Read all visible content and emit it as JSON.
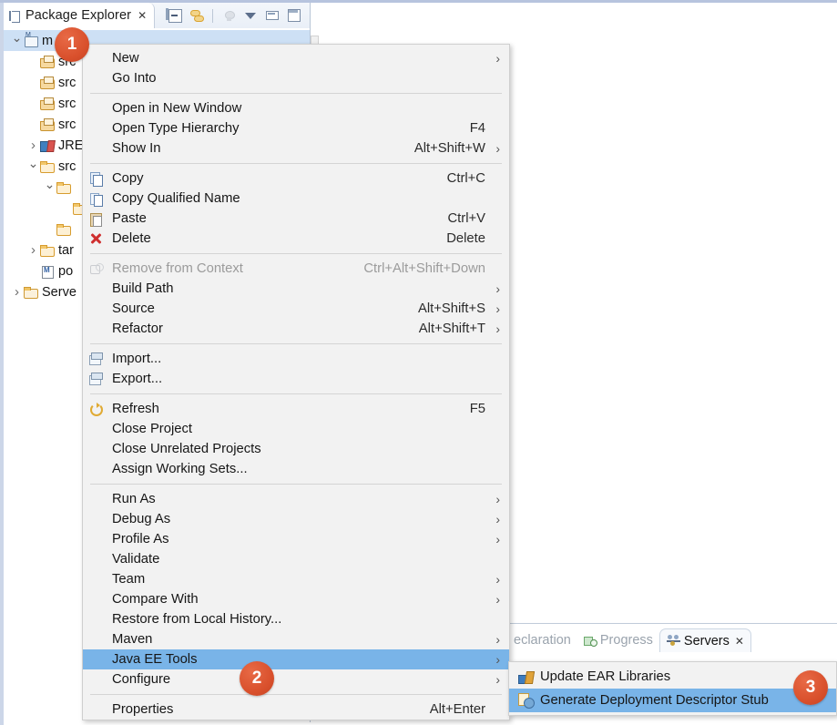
{
  "view": {
    "tab_title": "Package Explorer",
    "close_glyph": "✕",
    "toolbar": [
      {
        "name": "collapse-all-icon",
        "title": "Collapse All"
      },
      {
        "name": "link-with-editor-icon",
        "title": "Link with Editor"
      },
      {
        "name": "focus-on-active-task-icon",
        "title": "Focus on Active Task"
      },
      {
        "name": "view-menu-icon",
        "title": "View Menu"
      },
      {
        "name": "minimize-icon",
        "title": "Minimize"
      },
      {
        "name": "maximize-icon",
        "title": "Maximize"
      }
    ]
  },
  "tree": [
    {
      "arrow": "down",
      "icon": "project-icon",
      "label": "m      -first",
      "selected": true,
      "indent": 0
    },
    {
      "arrow": "none",
      "icon": "source-folder-icon",
      "label": "src",
      "selected": false,
      "indent": 1
    },
    {
      "arrow": "none",
      "icon": "source-folder-icon",
      "label": "src",
      "selected": false,
      "indent": 1
    },
    {
      "arrow": "none",
      "icon": "source-folder-icon",
      "label": "src",
      "selected": false,
      "indent": 1
    },
    {
      "arrow": "none",
      "icon": "source-folder-icon",
      "label": "src",
      "selected": false,
      "indent": 1
    },
    {
      "arrow": "right",
      "icon": "jre-library-icon",
      "label": "JRE",
      "selected": false,
      "indent": 1
    },
    {
      "arrow": "down",
      "icon": "folder-icon",
      "label": "src",
      "selected": false,
      "indent": 1
    },
    {
      "arrow": "down",
      "icon": "folder-icon",
      "label": "",
      "selected": false,
      "indent": 2
    },
    {
      "arrow": "none",
      "icon": "folder-icon",
      "label": "",
      "selected": false,
      "indent": 3
    },
    {
      "arrow": "none",
      "icon": "folder-icon",
      "label": "",
      "selected": false,
      "indent": 2
    },
    {
      "arrow": "right",
      "icon": "folder-icon",
      "label": "tar",
      "selected": false,
      "indent": 1
    },
    {
      "arrow": "none",
      "icon": "pom-file-icon",
      "label": "po",
      "selected": false,
      "indent": 1
    },
    {
      "arrow": "right",
      "icon": "servers-folder-icon",
      "label": "Serve",
      "selected": false,
      "indent": 0
    }
  ],
  "context_menu": [
    {
      "type": "item",
      "label": "New",
      "key": "",
      "arrow": true,
      "icon": "",
      "disabled": false,
      "highlight": false
    },
    {
      "type": "item",
      "label": "Go Into",
      "key": "",
      "arrow": false,
      "icon": "",
      "disabled": false,
      "highlight": false
    },
    {
      "type": "sep"
    },
    {
      "type": "item",
      "label": "Open in New Window",
      "key": "",
      "arrow": false,
      "icon": "",
      "disabled": false,
      "highlight": false
    },
    {
      "type": "item",
      "label": "Open Type Hierarchy",
      "key": "F4",
      "arrow": false,
      "icon": "",
      "disabled": false,
      "highlight": false
    },
    {
      "type": "item",
      "label": "Show In",
      "key": "Alt+Shift+W",
      "arrow": true,
      "icon": "",
      "disabled": false,
      "highlight": false
    },
    {
      "type": "sep"
    },
    {
      "type": "item",
      "label": "Copy",
      "key": "Ctrl+C",
      "arrow": false,
      "icon": "copy-icon",
      "disabled": false,
      "highlight": false
    },
    {
      "type": "item",
      "label": "Copy Qualified Name",
      "key": "",
      "arrow": false,
      "icon": "copy-qualified-name-icon",
      "disabled": false,
      "highlight": false
    },
    {
      "type": "item",
      "label": "Paste",
      "key": "Ctrl+V",
      "arrow": false,
      "icon": "paste-icon",
      "disabled": false,
      "highlight": false
    },
    {
      "type": "item",
      "label": "Delete",
      "key": "Delete",
      "arrow": false,
      "icon": "delete-icon",
      "disabled": false,
      "highlight": false
    },
    {
      "type": "sep"
    },
    {
      "type": "item",
      "label": "Remove from Context",
      "key": "Ctrl+Alt+Shift+Down",
      "arrow": false,
      "icon": "remove-from-context-icon",
      "disabled": true,
      "highlight": false
    },
    {
      "type": "item",
      "label": "Build Path",
      "key": "",
      "arrow": true,
      "icon": "",
      "disabled": false,
      "highlight": false
    },
    {
      "type": "item",
      "label": "Source",
      "key": "Alt+Shift+S",
      "arrow": true,
      "icon": "",
      "disabled": false,
      "highlight": false
    },
    {
      "type": "item",
      "label": "Refactor",
      "key": "Alt+Shift+T",
      "arrow": true,
      "icon": "",
      "disabled": false,
      "highlight": false
    },
    {
      "type": "sep"
    },
    {
      "type": "item",
      "label": "Import...",
      "key": "",
      "arrow": false,
      "icon": "import-icon",
      "disabled": false,
      "highlight": false
    },
    {
      "type": "item",
      "label": "Export...",
      "key": "",
      "arrow": false,
      "icon": "export-icon",
      "disabled": false,
      "highlight": false
    },
    {
      "type": "sep"
    },
    {
      "type": "item",
      "label": "Refresh",
      "key": "F5",
      "arrow": false,
      "icon": "refresh-icon",
      "disabled": false,
      "highlight": false
    },
    {
      "type": "item",
      "label": "Close Project",
      "key": "",
      "arrow": false,
      "icon": "",
      "disabled": false,
      "highlight": false
    },
    {
      "type": "item",
      "label": "Close Unrelated Projects",
      "key": "",
      "arrow": false,
      "icon": "",
      "disabled": false,
      "highlight": false
    },
    {
      "type": "item",
      "label": "Assign Working Sets...",
      "key": "",
      "arrow": false,
      "icon": "",
      "disabled": false,
      "highlight": false
    },
    {
      "type": "sep"
    },
    {
      "type": "item",
      "label": "Run As",
      "key": "",
      "arrow": true,
      "icon": "",
      "disabled": false,
      "highlight": false
    },
    {
      "type": "item",
      "label": "Debug As",
      "key": "",
      "arrow": true,
      "icon": "",
      "disabled": false,
      "highlight": false
    },
    {
      "type": "item",
      "label": "Profile As",
      "key": "",
      "arrow": true,
      "icon": "",
      "disabled": false,
      "highlight": false
    },
    {
      "type": "item",
      "label": "Validate",
      "key": "",
      "arrow": false,
      "icon": "",
      "disabled": false,
      "highlight": false
    },
    {
      "type": "item",
      "label": "Team",
      "key": "",
      "arrow": true,
      "icon": "",
      "disabled": false,
      "highlight": false
    },
    {
      "type": "item",
      "label": "Compare With",
      "key": "",
      "arrow": true,
      "icon": "",
      "disabled": false,
      "highlight": false
    },
    {
      "type": "item",
      "label": "Restore from Local History...",
      "key": "",
      "arrow": false,
      "icon": "",
      "disabled": false,
      "highlight": false
    },
    {
      "type": "item",
      "label": "Maven",
      "key": "",
      "arrow": true,
      "icon": "",
      "disabled": false,
      "highlight": false
    },
    {
      "type": "item",
      "label": "Java EE Tools",
      "key": "",
      "arrow": true,
      "icon": "",
      "disabled": false,
      "highlight": true
    },
    {
      "type": "item",
      "label": "Configure",
      "key": "",
      "arrow": true,
      "icon": "",
      "disabled": false,
      "highlight": false
    },
    {
      "type": "sep"
    },
    {
      "type": "item",
      "label": "Properties",
      "key": "Alt+Enter",
      "arrow": false,
      "icon": "",
      "disabled": false,
      "highlight": false
    }
  ],
  "submenu": {
    "items": [
      {
        "label": "Update EAR Libraries",
        "icon": "update-ear-libraries-icon",
        "highlight": false
      },
      {
        "label": "Generate Deployment Descriptor Stub",
        "icon": "deployment-descriptor-icon",
        "highlight": true
      }
    ]
  },
  "bottom_tabs": [
    {
      "label": "eclaration",
      "icon": "",
      "active": false,
      "close": ""
    },
    {
      "label": "Progress",
      "icon": "progress-icon",
      "active": false,
      "close": ""
    },
    {
      "label": "Servers",
      "icon": "servers-icon",
      "active": true,
      "close": "✕"
    }
  ],
  "badges": [
    {
      "id": "badge1",
      "label": "1"
    },
    {
      "id": "badge2",
      "label": "2"
    },
    {
      "id": "badge3",
      "label": "3"
    }
  ],
  "colors": {
    "menu_bg": "#f2f2f2",
    "highlight": "#79b4e8",
    "selection": "#cde0f5",
    "badge": "#d9502c",
    "window_chrome": "#b7c4de"
  }
}
